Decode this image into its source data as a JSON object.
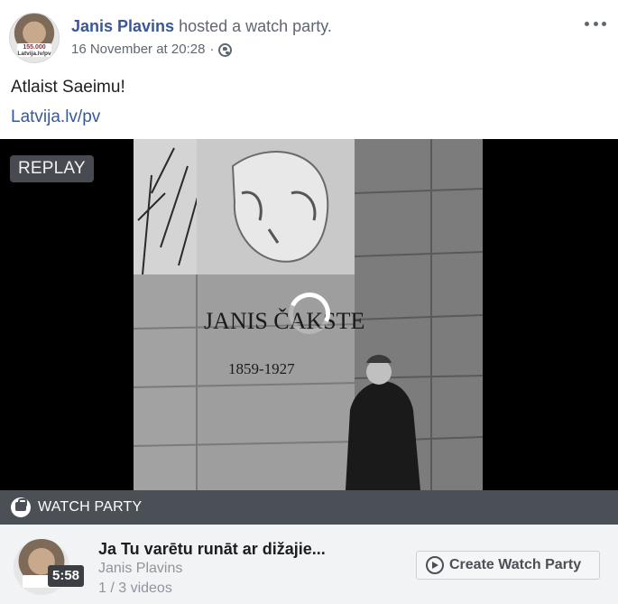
{
  "post": {
    "author": "Janis Plavins",
    "action": "hosted a watch party.",
    "timestamp": "16 November at 20:28",
    "separator": "·",
    "privacy_icon": "globe-icon",
    "avatar_badge_line1": "155.000",
    "avatar_badge_line2": "Latvija.lv/pv",
    "text": "Atlaist Saeimu!",
    "link": "Latvija.lv/pv",
    "more_icon": "more-options-icon"
  },
  "video": {
    "status_badge": "REPLAY",
    "loading_icon": "loading-spinner-icon"
  },
  "watch_party": {
    "bar_label": "WATCH PARTY",
    "bar_icon": "watch-party-icon",
    "title": "Ja Tu varētu runāt ar dižajie...",
    "host": "Janis Plavins",
    "video_count": "1 / 3 videos",
    "duration": "5:58",
    "create_button": "Create Watch Party",
    "create_icon": "watch-party-play-icon"
  },
  "colors": {
    "link_blue": "#385898",
    "secondary_text": "#606770",
    "bar_gray": "#4b4f56",
    "card_bg": "#f2f3f5"
  }
}
